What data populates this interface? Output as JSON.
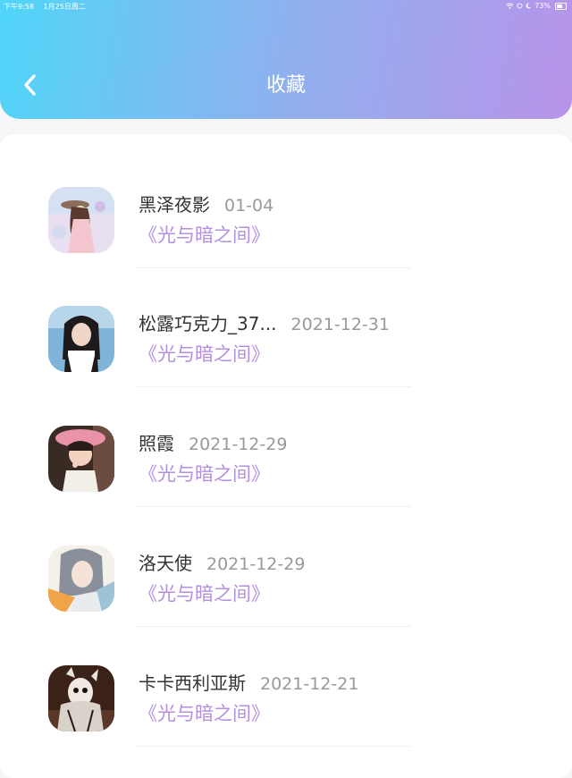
{
  "status_bar": {
    "time": "下午9:58",
    "date": "1月25日周二",
    "battery": "73%"
  },
  "header": {
    "title": "收藏",
    "back_icon": "chevron-left-icon"
  },
  "items": [
    {
      "name": "黑泽夜影",
      "date": "01-04",
      "work": "《光与暗之间》"
    },
    {
      "name": "松露巧克力_37...",
      "date": "2021-12-31",
      "work": "《光与暗之间》"
    },
    {
      "name": "照霞",
      "date": "2021-12-29",
      "work": "《光与暗之间》"
    },
    {
      "name": "洛天使",
      "date": "2021-12-29",
      "work": "《光与暗之间》"
    },
    {
      "name": "卡卡西利亚斯",
      "date": "2021-12-21",
      "work": "《光与暗之间》"
    }
  ],
  "colors": {
    "header_gradient_start": "#4fd6f8",
    "header_gradient_end": "#b893ea",
    "work_title": "#b48fe0",
    "name_text": "#333333",
    "date_text": "#999999"
  }
}
